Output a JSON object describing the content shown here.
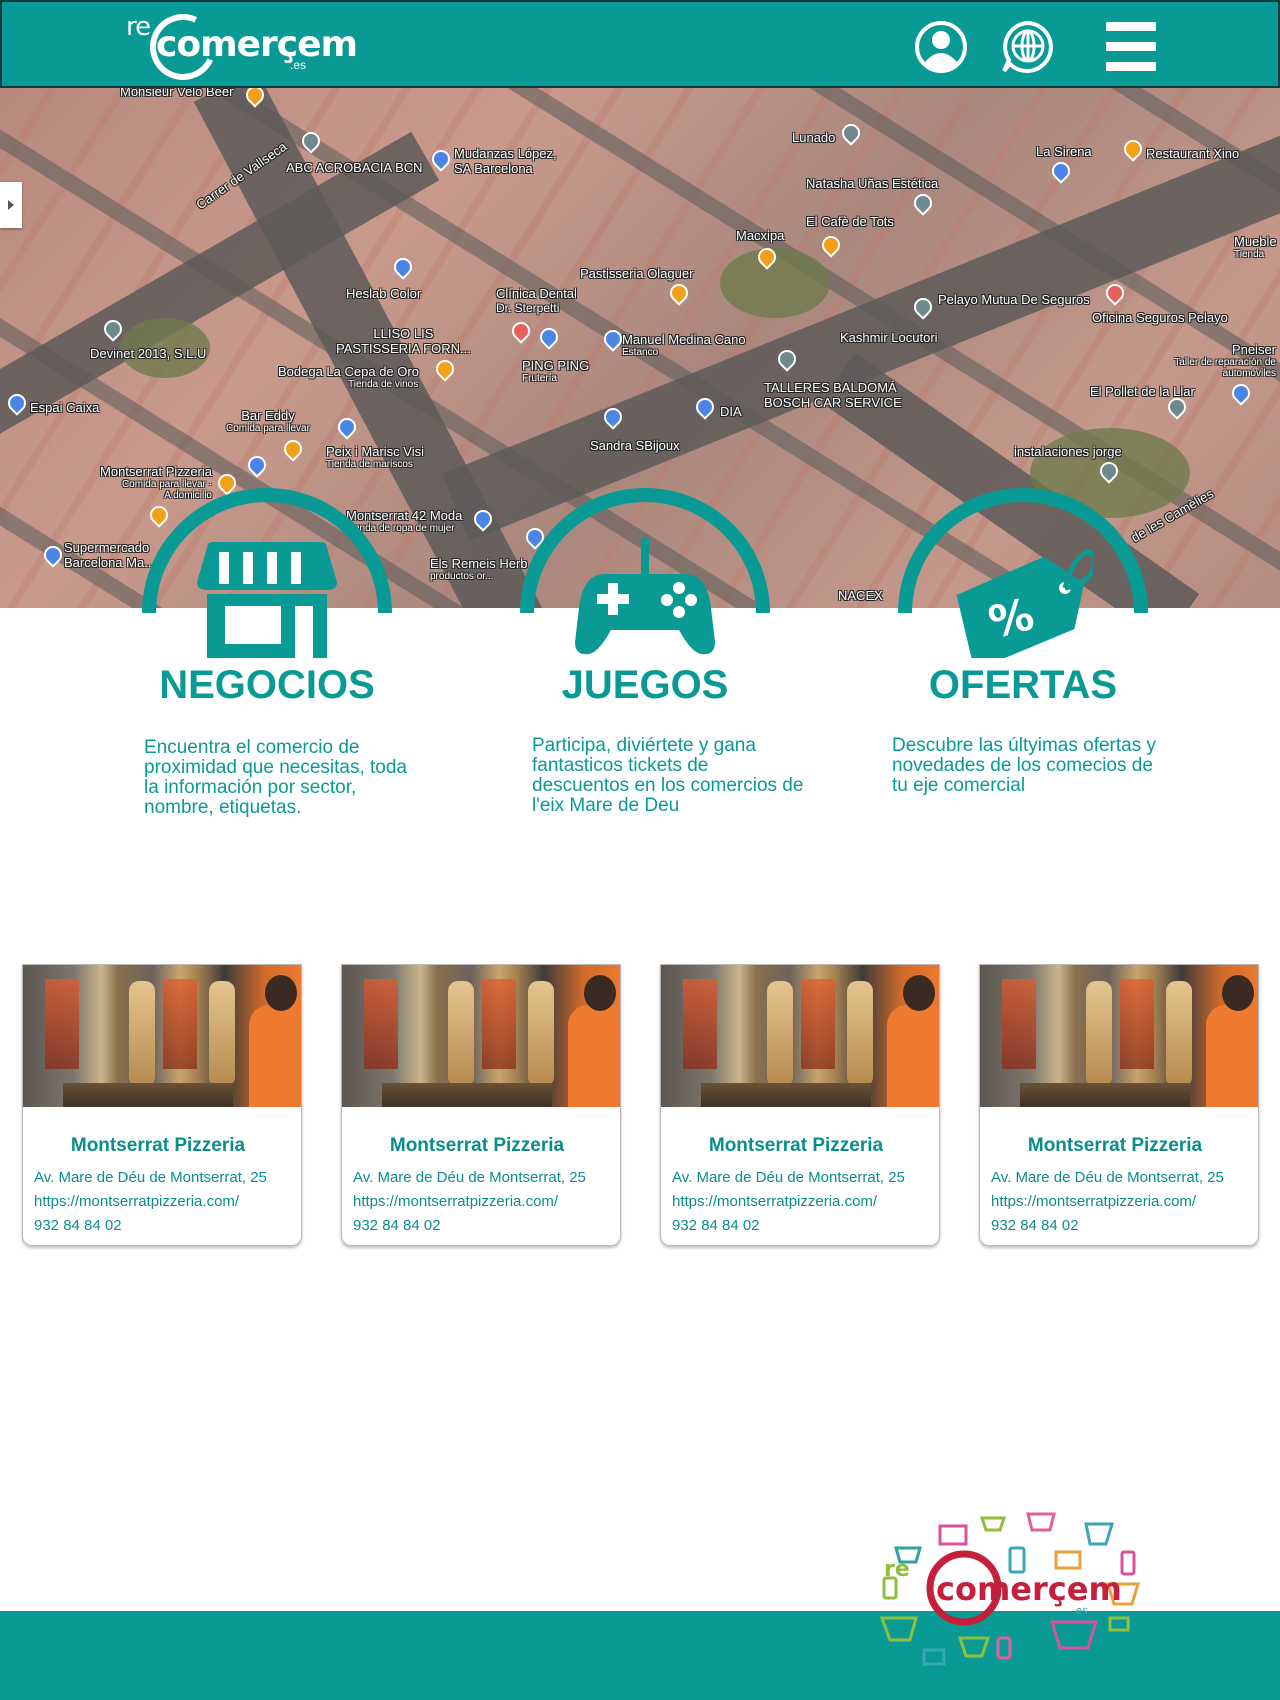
{
  "header": {
    "logo_prefix": "re",
    "logo_word": "comerçem",
    "logo_tld": ".es",
    "user_icon": "user-circle-icon",
    "globe_icon": "globe-chat-icon",
    "menu_icon": "hamburger-menu-icon",
    "background_color": "#0a9a96"
  },
  "map": {
    "labels": [
      {
        "text": "Monsieur Velo Beer",
        "sub": ""
      },
      {
        "text": "Carrer de Vallseca",
        "sub": ""
      },
      {
        "text": "ABC ACROBACIA BCN",
        "sub": ""
      },
      {
        "text": "Mudanzas López,",
        "sub": "SA Barcelona"
      },
      {
        "text": "Lunado",
        "sub": ""
      },
      {
        "text": "La Sirena",
        "sub": ""
      },
      {
        "text": "Restaurant Xino",
        "sub": ""
      },
      {
        "text": "Natasha Uñas Estética",
        "sub": ""
      },
      {
        "text": "Macxipa",
        "sub": ""
      },
      {
        "text": "El Cafè de Tots",
        "sub": ""
      },
      {
        "text": "Mueble",
        "sub": "Tienda"
      },
      {
        "text": "Pastisseria Olaguer",
        "sub": ""
      },
      {
        "text": "Heslab Color",
        "sub": ""
      },
      {
        "text": "Clínica Dental",
        "sub": "Dr. Sterpetti"
      },
      {
        "text": "Pelayo Mutua De Seguros",
        "sub": ""
      },
      {
        "text": "Oficina Seguros Pelayo",
        "sub": ""
      },
      {
        "text": "Devinet 2013, S.L.U",
        "sub": ""
      },
      {
        "text": "LLISO LIS",
        "sub": "PASTISSERIA FORN..."
      },
      {
        "text": "Manuel Medina Cano",
        "sub": "Estanco"
      },
      {
        "text": "Kashmir Locutori",
        "sub": ""
      },
      {
        "text": "Pneiser",
        "sub": "Taller de reparación de automóviles"
      },
      {
        "text": "Bodega La Cepa de Oro",
        "sub": "Tienda de vinos"
      },
      {
        "text": "PING PING",
        "sub": "Frutería"
      },
      {
        "text": "TALLERES BALDOMÁ",
        "sub": "BOSCH CAR SERVICE"
      },
      {
        "text": "El Pollet de la Llar",
        "sub": ""
      },
      {
        "text": "Espai Caixa",
        "sub": ""
      },
      {
        "text": "DIA",
        "sub": ""
      },
      {
        "text": "Bar Eddy",
        "sub": "Comida para llevar"
      },
      {
        "text": "Sandra SBijoux",
        "sub": ""
      },
      {
        "text": "Peix i Marisc Visi",
        "sub": "Tienda de mariscos"
      },
      {
        "text": "instalaciones jorge",
        "sub": ""
      },
      {
        "text": "Montserrat Pizzeria",
        "sub": "Comida para llevar · A domicilio"
      },
      {
        "text": "de les Camèlies",
        "sub": ""
      },
      {
        "text": "Montserrat 42 Moda",
        "sub": "Tienda de ropa de mujer"
      },
      {
        "text": "Supermercado",
        "sub": "Barcelona Ma..."
      },
      {
        "text": "Els Remeis Herb",
        "sub": "productos or..."
      },
      {
        "text": "NACEX",
        "sub": ""
      }
    ]
  },
  "features": [
    {
      "id": "negocios",
      "icon": "storefront-icon",
      "title": "NEGOCIOS",
      "description": [
        "Encuentra el comercio de",
        "proximidad que necesitas, toda",
        "la información por sector,",
        "nombre, etiquetas."
      ]
    },
    {
      "id": "juegos",
      "icon": "gamepad-icon",
      "title": "JUEGOS",
      "description": [
        "Participa, diviértete y gana",
        "fantasticos tickets de",
        "descuentos en los comercios de",
        "l'eix Mare de Deu"
      ]
    },
    {
      "id": "ofertas",
      "icon": "discount-tag-icon",
      "title": "OFERTAS",
      "description": [
        "Descubre las últyimas ofertas y",
        "novedades de los comecios de",
        "tu eje comercial"
      ]
    }
  ],
  "cards": [
    {
      "title": "Montserrat Pizzeria",
      "address": "Av. Mare de Déu de Montserrat, 25",
      "url": "https://montserratpizzeria.com/",
      "phone": "932 84 84 02"
    },
    {
      "title": "Montserrat Pizzeria",
      "address": "Av. Mare de Déu de Montserrat, 25",
      "url": "https://montserratpizzeria.com/",
      "phone": "932 84 84 02"
    },
    {
      "title": "Montserrat Pizzeria",
      "address": "Av. Mare de Déu de Montserrat, 25",
      "url": "https://montserratpizzeria.com/",
      "phone": "932 84 84 02"
    },
    {
      "title": "Montserrat Pizzeria",
      "address": "Av. Mare de Déu de Montserrat, 25",
      "url": "https://montserratpizzeria.com/",
      "phone": "932 84 84 02"
    }
  ],
  "footer": {
    "logo_prefix": "re",
    "logo_word": "comerçem",
    "logo_tld": ".es",
    "background_color": "#0a9a96"
  }
}
